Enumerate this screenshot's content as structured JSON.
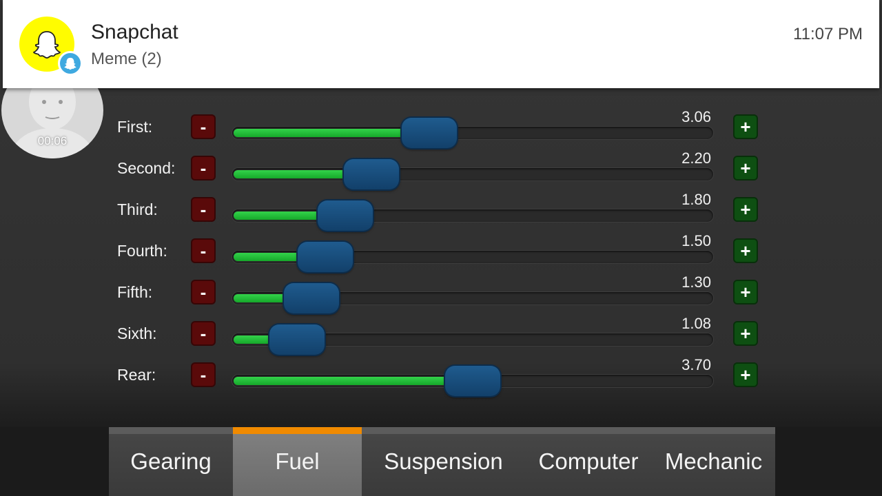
{
  "notification": {
    "app": "Snapchat",
    "message": "Meme (2)",
    "time": "11:07 PM",
    "icon": "snapchat-ghost-icon",
    "icon_color": "#fffc00"
  },
  "avatar": {
    "timer": "00:06"
  },
  "gears": [
    {
      "label": "First:",
      "value": "3.06",
      "level": 0.41
    },
    {
      "label": "Second:",
      "value": "2.20",
      "level": 0.29
    },
    {
      "label": "Third:",
      "value": "1.80",
      "level": 0.235
    },
    {
      "label": "Fourth:",
      "value": "1.50",
      "level": 0.193
    },
    {
      "label": "Fifth:",
      "value": "1.30",
      "level": 0.165
    },
    {
      "label": "Sixth:",
      "value": "1.08",
      "level": 0.135
    },
    {
      "label": "Rear:",
      "value": "3.70",
      "level": 0.5
    }
  ],
  "buttons": {
    "minus": "-",
    "plus": "+"
  },
  "tabs": [
    {
      "label": "Gearing",
      "active": false
    },
    {
      "label": "Fuel",
      "active": true
    },
    {
      "label": "Suspension",
      "active": false
    },
    {
      "label": "Computer",
      "active": false
    },
    {
      "label": "Mechanic",
      "active": false
    }
  ],
  "colors": {
    "accent": "#f08a00",
    "slider_fill": "#1fb634",
    "slider_thumb": "#1a4f7e",
    "minus_button": "#5a0a0a",
    "plus_button": "#0e4f12"
  }
}
